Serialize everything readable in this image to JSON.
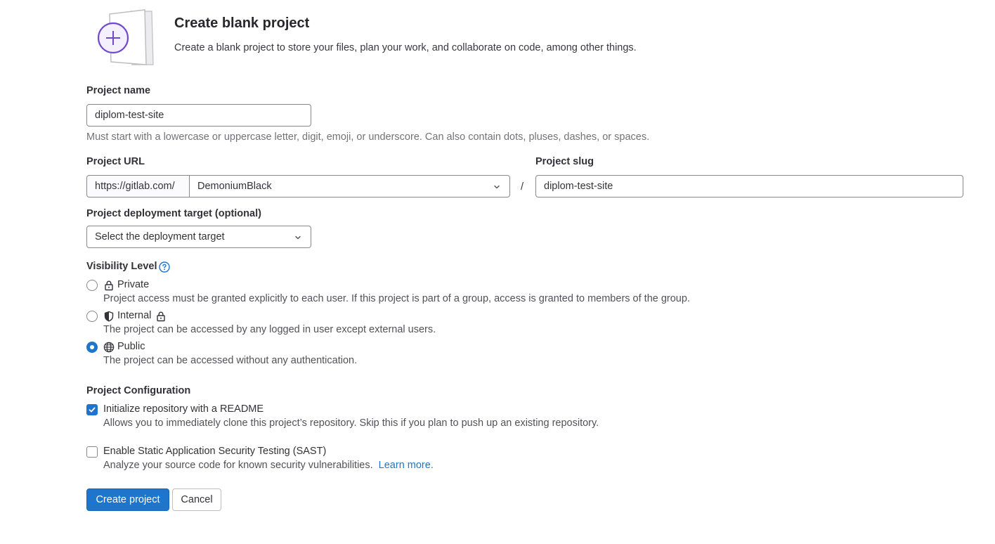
{
  "header": {
    "title": "Create blank project",
    "description": "Create a blank project to store your files, plan your work, and collaborate on code, among other things."
  },
  "project_name": {
    "label": "Project name",
    "value": "diplom-test-site",
    "help": "Must start with a lowercase or uppercase letter, digit, emoji, or underscore. Can also contain dots, pluses, dashes, or spaces."
  },
  "project_url": {
    "label": "Project URL",
    "prefix": "https://gitlab.com/",
    "namespace": "DemoniumBlack",
    "separator": "/"
  },
  "project_slug": {
    "label": "Project slug",
    "value": "diplom-test-site"
  },
  "deployment_target": {
    "label": "Project deployment target (optional)",
    "placeholder": "Select the deployment target"
  },
  "visibility": {
    "label": "Visibility Level",
    "help_icon": "question-circle-icon",
    "options": [
      {
        "name": "Private",
        "icon": "lock-icon",
        "description": "Project access must be granted explicitly to each user. If this project is part of a group, access is granted to members of the group.",
        "selected": false
      },
      {
        "name": "Internal",
        "icon": "shield-icon",
        "extra_icon": "lock-icon",
        "description": "The project can be accessed by any logged in user except external users.",
        "selected": false
      },
      {
        "name": "Public",
        "icon": "globe-icon",
        "description": "The project can be accessed without any authentication.",
        "selected": true
      }
    ]
  },
  "configuration": {
    "label": "Project Configuration",
    "readme": {
      "label": "Initialize repository with a README",
      "description": "Allows you to immediately clone this project’s repository. Skip this if you plan to push up an existing repository.",
      "checked": true
    },
    "sast": {
      "label": "Enable Static Application Security Testing (SAST)",
      "description": "Analyze your source code for known security vulnerabilities.",
      "link": "Learn more.",
      "checked": false
    }
  },
  "actions": {
    "create": "Create project",
    "cancel": "Cancel"
  },
  "colors": {
    "primary": "#1f75cb",
    "illustration_accent": "#6e49cb"
  }
}
